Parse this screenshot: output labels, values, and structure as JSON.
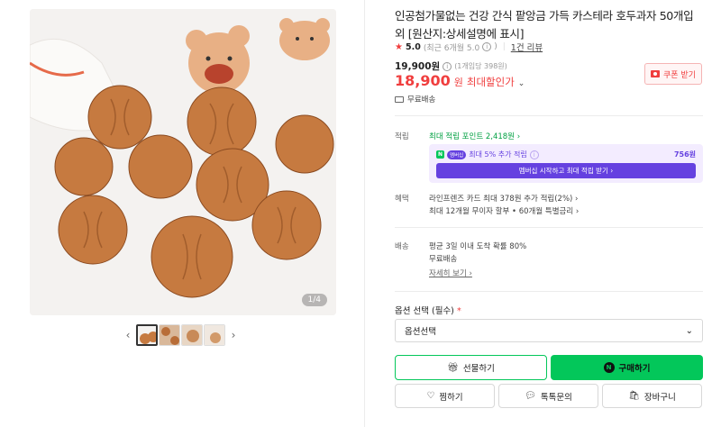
{
  "gallery": {
    "page_indicator": "1/4",
    "prev_arrow": "‹",
    "next_arrow": "›"
  },
  "product": {
    "title": "인공첨가물없는 건강 간식 팥앙금 가득 카스테라 호두과자 50개입 외 [원산지:상세설명에 표시]",
    "rating": {
      "star": "★",
      "score": "5.0",
      "recent": "(최근 6개월 5.0",
      "recent_close": ")",
      "reviews": "1건 리뷰"
    },
    "original_price": "19,900원",
    "unit_price": "(1개입당 398원)",
    "sale_price": "18,900",
    "sale_won": "원",
    "sale_label": "최대할인가",
    "sale_chevron": "⌄",
    "coupon_button": "쿠폰 받기",
    "shipping_fee": "무료배송"
  },
  "points": {
    "label": "적립",
    "max_point": "최대 적립 포인트 2,418원 ›",
    "member_badge": "N",
    "member_badge2": "멤버십",
    "member_text": "최대 5% 추가 적립",
    "member_amount": "756원",
    "member_button": "멤버십 시작하고 최대 적립 받기 ›"
  },
  "benefits": {
    "label": "혜택",
    "line1": "라인프렌즈 카드 최대 378원 추가 적립(2%) ›",
    "line2": "최대 12개월 무이자 할부 • 60개월 특별금리 ›"
  },
  "delivery": {
    "label": "배송",
    "line1": "평균 3일 이내 도착 확률 80%",
    "line2": "무료배송",
    "detail_link": "자세히 보기 ›"
  },
  "options": {
    "label": "옵션 선택 (필수)",
    "required_mark": "*",
    "select_value": "옵션선택",
    "select_chevron": "⌄"
  },
  "actions": {
    "gift": "선물하기",
    "buy": "구매하기",
    "zzim": "찜하기",
    "talk": "톡톡문의",
    "cart": "장바구니"
  },
  "colors": {
    "accent_red": "#f03e3e",
    "naver_green": "#03c75a",
    "membership_purple": "#6541e0"
  }
}
